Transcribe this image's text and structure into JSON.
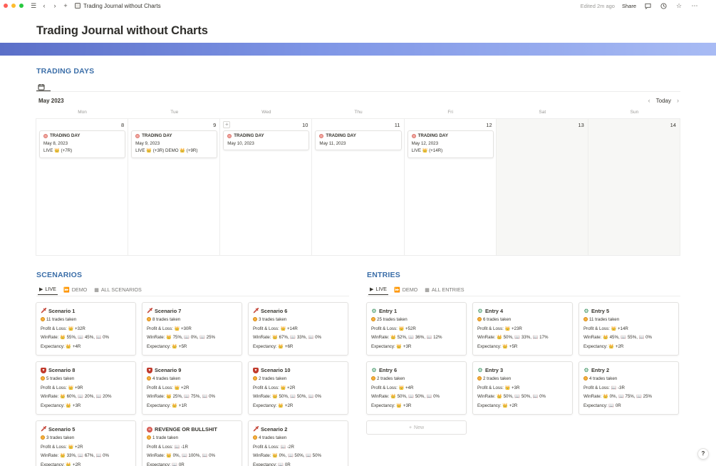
{
  "topbar": {
    "page_title": "Trading Journal without Charts",
    "edited": "Edited 2m ago",
    "share": "Share"
  },
  "page": {
    "title": "Trading Journal without Charts"
  },
  "trading_days": {
    "heading": "TRADING DAYS",
    "month": "May 2023",
    "today": "Today",
    "weekdays": [
      "Mon",
      "Tue",
      "Wed",
      "Thu",
      "Fri",
      "Sat",
      "Sun"
    ],
    "days": [
      {
        "num": "8",
        "card": {
          "title": "TRADING DAY",
          "date": "May 8, 2023",
          "result": "LIVE 👑 (+7R)"
        }
      },
      {
        "num": "9",
        "card": {
          "title": "TRADING DAY",
          "date": "May 9, 2023",
          "result": "LIVE 👑 (+3R) DEMO 👑 (+9R)"
        }
      },
      {
        "num": "10",
        "card": {
          "title": "TRADING DAY",
          "date": "May 10, 2023",
          "result": ""
        }
      },
      {
        "num": "11",
        "card": {
          "title": "TRADING DAY",
          "date": "May 11, 2023",
          "result": ""
        }
      },
      {
        "num": "12",
        "card": {
          "title": "TRADING DAY",
          "date": "May 12, 2023",
          "result": "LIVE 👑 (+14R)"
        }
      },
      {
        "num": "13"
      },
      {
        "num": "14"
      }
    ]
  },
  "scenarios": {
    "heading": "SCENARIOS",
    "tabs": [
      "LIVE",
      "DEMO",
      "ALL SCENARIOS"
    ],
    "cards": [
      {
        "icon": "sword",
        "title": "Scenario 1",
        "trades": "11 trades taken",
        "pl": "Profit & Loss: 👑 +32R",
        "winrate": "WinRate: 👑 55%, 📖 45%, 📖 0%",
        "exp": "Expectancy: 👑 +4R"
      },
      {
        "icon": "sword",
        "title": "Scenario 7",
        "trades": "8 trades taken",
        "pl": "Profit & Loss: 👑 +30R",
        "winrate": "WinRate: 👑 75%, 📖 0%, 📖 25%",
        "exp": "Expectancy: 👑 +5R"
      },
      {
        "icon": "sword",
        "title": "Scenario 6",
        "trades": "3 trades taken",
        "pl": "Profit & Loss: 👑 +14R",
        "winrate": "WinRate: 👑 67%, 📖 33%, 📖 0%",
        "exp": "Expectancy: 👑 +6R"
      },
      {
        "icon": "shield",
        "title": "Scenario 8",
        "trades": "5 trades taken",
        "pl": "Profit & Loss: 👑 +9R",
        "winrate": "WinRate: 👑 60%, 📖 20%, 📖 20%",
        "exp": "Expectancy: 👑 +3R"
      },
      {
        "icon": "shield",
        "title": "Scenario 9",
        "trades": "4 trades taken",
        "pl": "Profit & Loss: 👑 +2R",
        "winrate": "WinRate: 👑 25%, 📖 75%, 📖 0%",
        "exp": "Expectancy: 👑 +1R"
      },
      {
        "icon": "shield",
        "title": "Scenario 10",
        "trades": "2 trades taken",
        "pl": "Profit & Loss: 👑 +2R",
        "winrate": "WinRate: 👑 50%, 📖 50%, 📖 0%",
        "exp": "Expectancy: 👑 +2R"
      },
      {
        "icon": "sword",
        "title": "Scenario 5",
        "trades": "3 trades taken",
        "pl": "Profit & Loss: 👑 +2R",
        "winrate": "WinRate: 👑 33%, 📖 67%, 📖 0%",
        "exp": "Expectancy: 👑 +2R"
      },
      {
        "icon": "skull",
        "title": "REVENGE OR BULLSHIT",
        "trades": "1 trade taken",
        "pl": "Profit & Loss: 📖 -1R",
        "winrate": "WinRate: 👑 0%, 📖 100%, 📖 0%",
        "exp": "Expectancy: 📖 0R"
      },
      {
        "icon": "sword",
        "title": "Scenario 2",
        "trades": "4 trades taken",
        "pl": "Profit & Loss: 📖 -2R",
        "winrate": "WinRate: 👑 0%, 📖 50%, 📖 50%",
        "exp": "Expectancy: 📖 0R"
      }
    ]
  },
  "entries": {
    "heading": "ENTRIES",
    "tabs": [
      "LIVE",
      "DEMO",
      "ALL ENTRIES"
    ],
    "new_label": "New",
    "cards": [
      {
        "icon": "gear",
        "title": "Entry 1",
        "trades": "25 trades taken",
        "pl": "Profit & Loss: 👑 +52R",
        "winrate": "WinRate: 👑 52%, 📖 36%, 📖 12%",
        "exp": "Expectancy: 👑 +3R"
      },
      {
        "icon": "gear",
        "title": "Entry 4",
        "trades": "6 trades taken",
        "pl": "Profit & Loss: 👑 +23R",
        "winrate": "WinRate: 👑 50%, 📖 33%, 📖 17%",
        "exp": "Expectancy: 👑 +5R"
      },
      {
        "icon": "gear",
        "title": "Entry 5",
        "trades": "11 trades taken",
        "pl": "Profit & Loss: 👑 +14R",
        "winrate": "WinRate: 👑 45%, 📖 55%, 📖 0%",
        "exp": "Expectancy: 👑 +2R"
      },
      {
        "icon": "gear",
        "title": "Entry 6",
        "trades": "2 trades taken",
        "pl": "Profit & Loss: 👑 +4R",
        "winrate": "WinRate: 👑 50%, 📖 50%, 📖 0%",
        "exp": "Expectancy: 👑 +3R"
      },
      {
        "icon": "gear",
        "title": "Entry 3",
        "trades": "2 trades taken",
        "pl": "Profit & Loss: 👑 +3R",
        "winrate": "WinRate: 👑 50%, 📖 50%, 📖 0%",
        "exp": "Expectancy: 👑 +2R"
      },
      {
        "icon": "gear",
        "title": "Entry 2",
        "trades": "4 trades taken",
        "pl": "Profit & Loss: 📖 -3R",
        "winrate": "WinRate: 👑 0%, 📖 75%, 📖 25%",
        "exp": "Expectancy: 📖 0R"
      }
    ]
  },
  "help": "?"
}
